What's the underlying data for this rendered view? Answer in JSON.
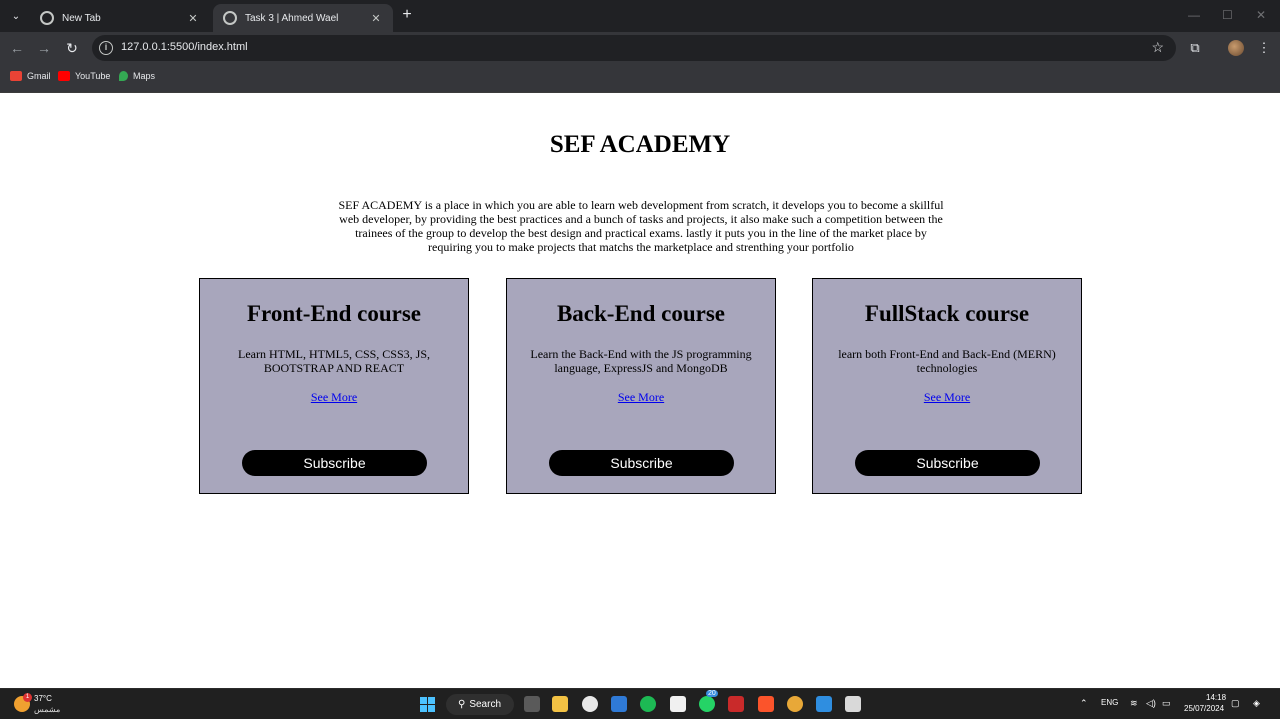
{
  "browser": {
    "tabs": [
      {
        "title": "New Tab",
        "close": "✕"
      },
      {
        "title": "Task 3 | Ahmed Wael",
        "close": "✕"
      }
    ],
    "new_tab_glyph": "+",
    "url": "127.0.0.1:5500/index.html",
    "bookmarks": [
      {
        "label": "Gmail",
        "color": "#ea4335"
      },
      {
        "label": "YouTube",
        "color": "#ff0000"
      },
      {
        "label": "Maps",
        "color": "#34a853"
      }
    ]
  },
  "page": {
    "title": "SEF ACADEMY",
    "intro": "SEF ACADEMY is a place in which you are able to learn web development from scratch, it develops you to become a skillful web developer, by providing the best practices and a bunch of tasks and projects, it also make such a competition between the trainees of the group to develop the best design and practical exams. lastly it puts you in the line of the market place by requiring you to make projects that matchs the marketplace and strenthing your portfolio",
    "cards": [
      {
        "heading": "Front-End course",
        "description": "Learn HTML, HTML5, CSS, CSS3, JS, BOOTSTRAP AND REACT",
        "link": "See More",
        "button": "Subscribe"
      },
      {
        "heading": "Back-End course",
        "description": "Learn the Back-End with the JS programming language, ExpressJS and MongoDB",
        "link": "See More",
        "button": "Subscribe"
      },
      {
        "heading": "FullStack course",
        "description": "learn both Front-End and Back-End (MERN) technologies",
        "link": "See More",
        "button": "Subscribe"
      }
    ],
    "card_color": "#a8a6bc"
  },
  "taskbar": {
    "weather_temp": "37°C",
    "weather_desc": "مشمس",
    "weather_badge": "1",
    "search_label": "Search",
    "whatsapp_badge": "20",
    "language": "ENG",
    "time": "14:18",
    "date": "25/07/2024"
  }
}
